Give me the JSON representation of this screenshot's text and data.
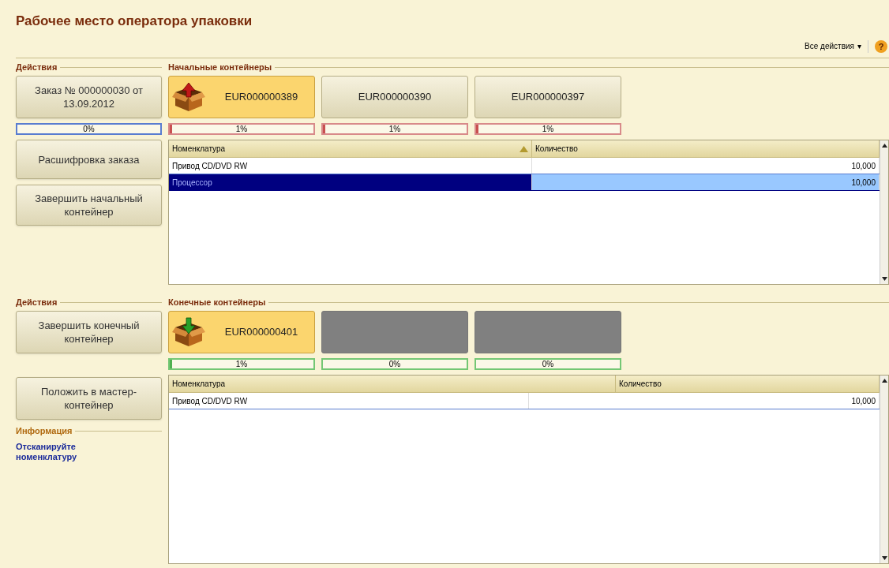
{
  "window": {
    "title": "Рабочее место оператора упаковки"
  },
  "toolbar": {
    "all_actions": "Все действия",
    "arrow": "▾",
    "help": "?"
  },
  "top": {
    "actions_label": "Действия",
    "actions": [
      {
        "label": "Заказ № 000000030 от 13.09.2012"
      },
      {
        "label": "Расшифровка заказа"
      },
      {
        "label": "Завершить начальный контейнер"
      }
    ],
    "order_progress": {
      "text": "0%",
      "level": 0
    },
    "containers_label": "Начальные контейнеры",
    "kind": "start",
    "containers": [
      {
        "kind": "filled",
        "code": "EUR000000389",
        "selected": true,
        "progress": "1%",
        "level": 0.01
      },
      {
        "kind": "filled",
        "code": "EUR000000390",
        "selected": false,
        "progress": "1%",
        "level": 0.01
      },
      {
        "kind": "filled",
        "code": "EUR000000397",
        "selected": false,
        "progress": "1%",
        "level": 0.01
      }
    ],
    "table": {
      "columns": [
        {
          "label": "Номенклатура",
          "sorted": true
        },
        {
          "label": "Количество",
          "sorted": false
        }
      ],
      "rows": [
        {
          "cells": [
            "Привод CD/DVD RW",
            "10,000"
          ],
          "selected": false
        },
        {
          "cells": [
            "Процессор",
            "10,000"
          ],
          "selected": true
        }
      ]
    }
  },
  "bottom": {
    "actions_label": "Действия",
    "actions": [
      {
        "label": "Завершить конечный контейнер"
      },
      {
        "label": "Положить в мастер-контейнер"
      }
    ],
    "info_label": "Информация",
    "info_text": "Отсканируйте номенклатуру",
    "containers_label": "Конечные контейнеры",
    "kind": "end",
    "containers": [
      {
        "kind": "filled",
        "code": "EUR000000401",
        "selected": true,
        "progress": "1%",
        "level": 0.01
      },
      {
        "kind": "empty",
        "selected": false,
        "progress": "0%",
        "level": 0
      },
      {
        "kind": "empty",
        "selected": false,
        "progress": "0%",
        "level": 0
      }
    ],
    "table": {
      "columns": [
        {
          "label": "Номенклатура",
          "sorted": false
        },
        {
          "label": "Количество",
          "sorted": false
        }
      ],
      "rows": [
        {
          "cells": [
            "Привод CD/DVD RW",
            "10,000"
          ],
          "selected": false
        }
      ]
    }
  }
}
